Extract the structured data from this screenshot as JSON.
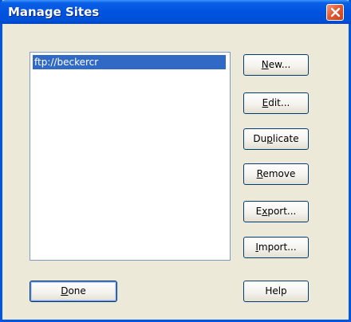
{
  "window": {
    "title": "Manage Sites",
    "close_label": "×"
  },
  "sites": {
    "items": [
      {
        "label": "ftp://beckercr",
        "selected": true
      }
    ]
  },
  "buttons": {
    "new": {
      "label": "New...",
      "mnemonic": "N"
    },
    "edit": {
      "label": "Edit...",
      "mnemonic": "E"
    },
    "duplicate": {
      "label": "Duplicate",
      "mnemonic": "p"
    },
    "remove": {
      "label": "Remove",
      "mnemonic": "R"
    },
    "export": {
      "label": "Export...",
      "mnemonic": "x"
    },
    "import": {
      "label": "Import...",
      "mnemonic": "I"
    },
    "done": {
      "label": "Done",
      "mnemonic": "D"
    },
    "help": {
      "label": "Help",
      "mnemonic": ""
    }
  },
  "colors": {
    "titlebar": "#0053e0",
    "selection": "#316ac5",
    "dialog_bg": "#ece9d8",
    "close_button": "#e35a32"
  }
}
